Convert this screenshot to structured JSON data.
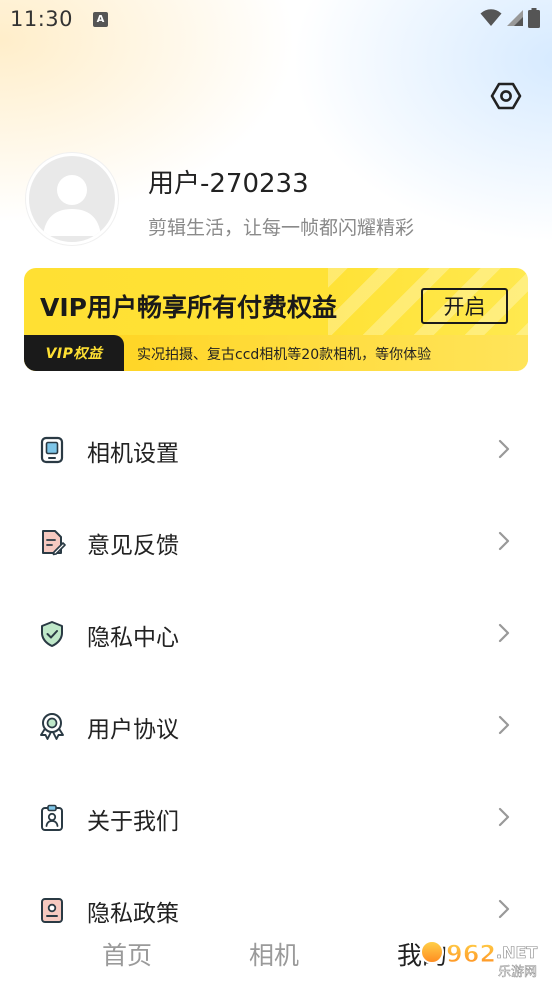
{
  "status": {
    "time": "11:30",
    "indicator": "A"
  },
  "profile": {
    "username": "用户-270233",
    "slogan": "剪辑生活，让每一帧都闪耀精彩"
  },
  "vip": {
    "title": "VIP用户畅享所有付费权益",
    "button_label": "开启",
    "tag": "VIP权益",
    "description": "实况拍摄、复古ccd相机等20款相机，等你体验",
    "accent": "#FFE033"
  },
  "menu": [
    {
      "label": "相机设置",
      "icon": "tablet-icon"
    },
    {
      "label": "意见反馈",
      "icon": "feedback-icon"
    },
    {
      "label": "隐私中心",
      "icon": "shield-check-icon"
    },
    {
      "label": "用户协议",
      "icon": "award-ribbon-icon"
    },
    {
      "label": "关于我们",
      "icon": "id-badge-icon"
    },
    {
      "label": "隐私政策",
      "icon": "privacy-card-icon"
    }
  ],
  "nav": {
    "tabs": [
      {
        "label": "首页"
      },
      {
        "label": "相机"
      },
      {
        "label": "我的"
      }
    ],
    "active": 2
  },
  "watermark": {
    "text_main": "962.NET",
    "text_sub": "乐游网"
  }
}
